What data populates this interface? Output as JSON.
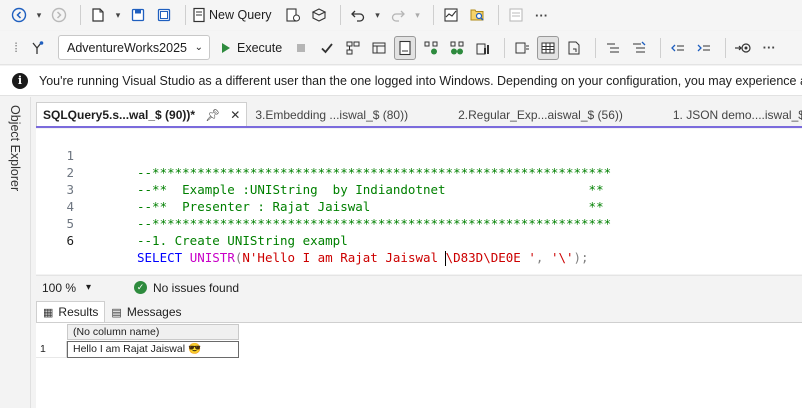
{
  "toolbar1": {
    "new_query_label": "New Query"
  },
  "toolbar2": {
    "database": "AdventureWorks2025",
    "execute_label": "Execute"
  },
  "infobar": {
    "message": "You're running Visual Studio as a different user than the one logged into Windows. Depending on your configuration, you may experience a degr"
  },
  "object_explorer": {
    "label": "Object Explorer"
  },
  "tabs": [
    {
      "label": "SQLQuery5.s...wal_$ (90))*"
    },
    {
      "label": "3.Embedding ...iswal_$ (80))"
    },
    {
      "label": "2.Regular_Exp...aiswal_$ (56))"
    },
    {
      "label": "1. JSON demo....iswal_$ ("
    }
  ],
  "editor": {
    "lines": [
      {
        "num": "1",
        "text": "--*************************************************************"
      },
      {
        "num": "2",
        "text": "--**  Example :UNIString  by Indiandotnet                   **"
      },
      {
        "num": "3",
        "text": "--**  Presenter : Rajat Jaiswal                             **"
      },
      {
        "num": "4",
        "text": "--*************************************************************"
      },
      {
        "num": "5",
        "text": "--1. Create UNIString exampl"
      },
      {
        "num": "6",
        "select": "SELECT",
        "func": "UNISTR",
        "paren_open": "(",
        "str1a": "N'Hello I am Rajat Jaiswal ",
        "str1b": "\\D83D\\DE0E '",
        "comma": ",",
        "str2": " '\\'",
        "close": ");"
      }
    ]
  },
  "status": {
    "zoom": "100 %",
    "issues": "No issues found"
  },
  "results": {
    "tabs": [
      {
        "label": "Results"
      },
      {
        "label": "Messages"
      }
    ],
    "column_header": "(No column name)",
    "row_number": "1",
    "cell_value": "Hello I am Rajat Jaiswal 😎"
  }
}
